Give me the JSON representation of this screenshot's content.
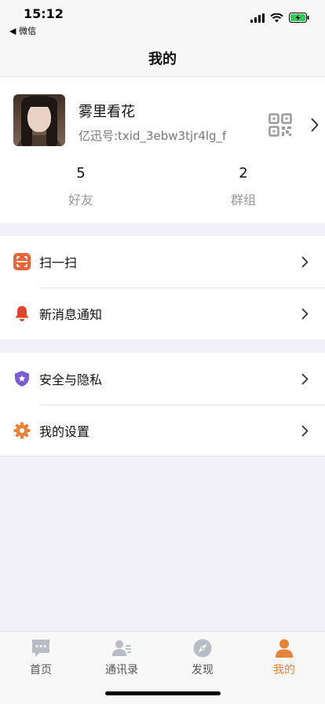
{
  "status_bar": {
    "time": "15:12",
    "back_label": "◀ 微信"
  },
  "nav": {
    "title": "我的"
  },
  "profile": {
    "name": "雾里看花",
    "id_text": "亿迅号:txid_3ebw3tjr4lg_f",
    "stats": [
      {
        "count": "5",
        "label": "好友"
      },
      {
        "count": "2",
        "label": "群组"
      }
    ]
  },
  "menu_groups": [
    [
      {
        "label": "扫一扫",
        "icon": "scan-icon",
        "color": "#e8643a"
      },
      {
        "label": "新消息通知",
        "icon": "bell-icon",
        "color": "#e0442e"
      }
    ],
    [
      {
        "label": "安全与隐私",
        "icon": "shield-icon",
        "color": "#7b5cd6"
      },
      {
        "label": "我的设置",
        "icon": "gear-icon",
        "color": "#e8843a"
      }
    ]
  ],
  "tabs": [
    {
      "label": "首页",
      "icon": "chat-icon"
    },
    {
      "label": "通讯录",
      "icon": "contacts-icon"
    },
    {
      "label": "发现",
      "icon": "compass-icon"
    },
    {
      "label": "我的",
      "icon": "person-icon",
      "active": true
    }
  ],
  "colors": {
    "accent": "#e8843a",
    "tab_inactive": "#b8bcc4"
  }
}
